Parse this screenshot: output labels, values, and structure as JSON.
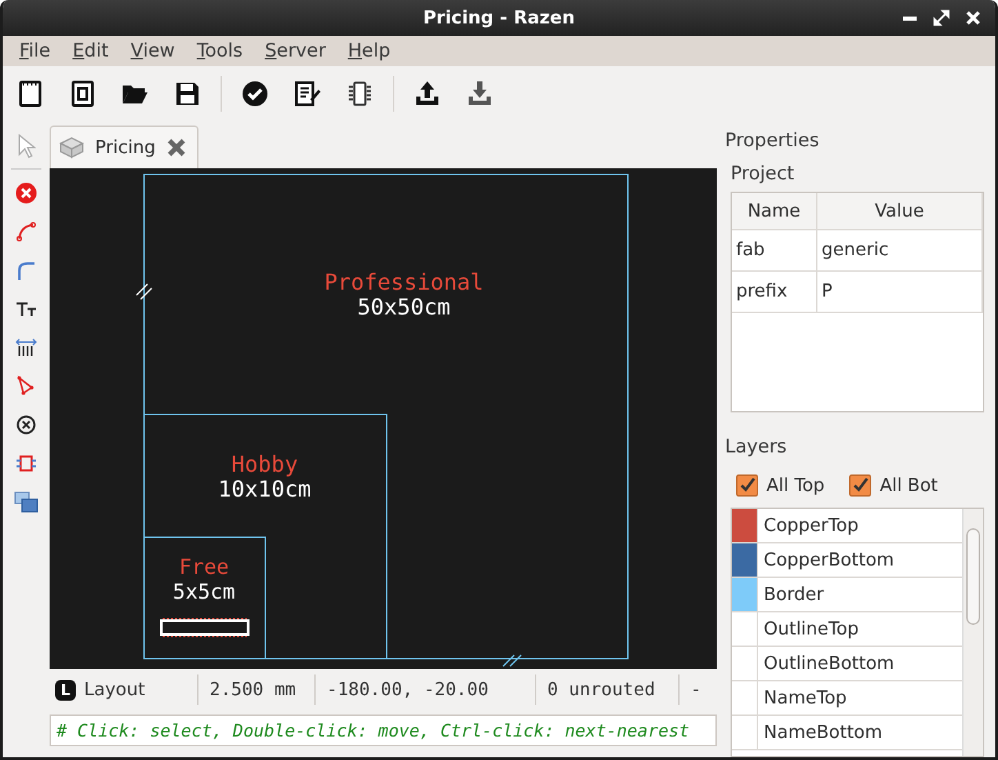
{
  "window": {
    "title": "Pricing - Razen"
  },
  "menu": [
    "File",
    "Edit",
    "View",
    "Tools",
    "Server",
    "Help"
  ],
  "document_tab": {
    "label": "Pricing",
    "selected": true
  },
  "canvas": {
    "boards": [
      {
        "name": "Professional",
        "size": "50x50cm"
      },
      {
        "name": "Hobby",
        "size": "10x10cm"
      },
      {
        "name": "Free",
        "size": "5x5cm"
      }
    ]
  },
  "status_bar": {
    "mode_badge": "L",
    "mode": "Layout",
    "grid": "2.500 mm",
    "cursor": "-180.00, -20.00",
    "unrouted": "0 unrouted",
    "column_5": "-"
  },
  "command_line": {
    "value": "# Click: select, Double-click: move, Ctrl-click: next-nearest"
  },
  "properties": {
    "title": "Properties",
    "section": "Project",
    "columns": [
      "Name",
      "Value"
    ],
    "rows": [
      [
        "fab",
        "generic"
      ],
      [
        "prefix",
        "P"
      ]
    ]
  },
  "layers": {
    "title": "Layers",
    "toggles": [
      {
        "label": "All Top",
        "checked": true
      },
      {
        "label": "All Bot",
        "checked": true
      }
    ],
    "items": [
      {
        "name": "CopperTop",
        "color": "#cc4c3f"
      },
      {
        "name": "CopperBottom",
        "color": "#3b6aa3"
      },
      {
        "name": "Border",
        "color": "#7ecbf9"
      },
      {
        "name": "OutlineTop"
      },
      {
        "name": "OutlineBottom"
      },
      {
        "name": "NameTop"
      },
      {
        "name": "NameBottom"
      }
    ]
  }
}
